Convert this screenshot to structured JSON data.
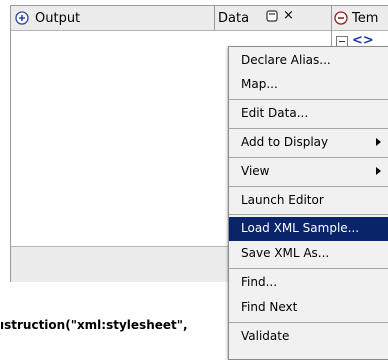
{
  "output_panel": {
    "title": "Output",
    "data_column": "Data",
    "minimize_glyph": "□",
    "close_glyph": "×"
  },
  "template_panel": {
    "title": "Tem",
    "tree_tag": "<>"
  },
  "code_text": "ıstruction(\"xml:stylesheet\",",
  "context_menu": {
    "items": [
      {
        "label": "Declare Alias..."
      },
      {
        "label": "Map..."
      },
      {
        "label": "Edit Data..."
      },
      {
        "label": "Add to Display"
      },
      {
        "label": "View"
      },
      {
        "label": "Launch Editor"
      },
      {
        "label": "Load XML Sample..."
      },
      {
        "label": "Save XML As..."
      },
      {
        "label": "Find..."
      },
      {
        "label": "Find Next"
      },
      {
        "label": "Validate"
      }
    ],
    "highlighted_item": "Load XML Sample..."
  },
  "colors": {
    "highlight": "#0a246a",
    "panel_header": "#ececec",
    "menu_background": "#f1f1f1"
  },
  "icons": [
    "add-circle-icon",
    "minimize-icon",
    "close-icon",
    "remove-circle-icon",
    "tree-collapse-icon",
    "xml-tag-icon",
    "tree-expand-icon",
    "submenu-arrow-icon"
  ]
}
